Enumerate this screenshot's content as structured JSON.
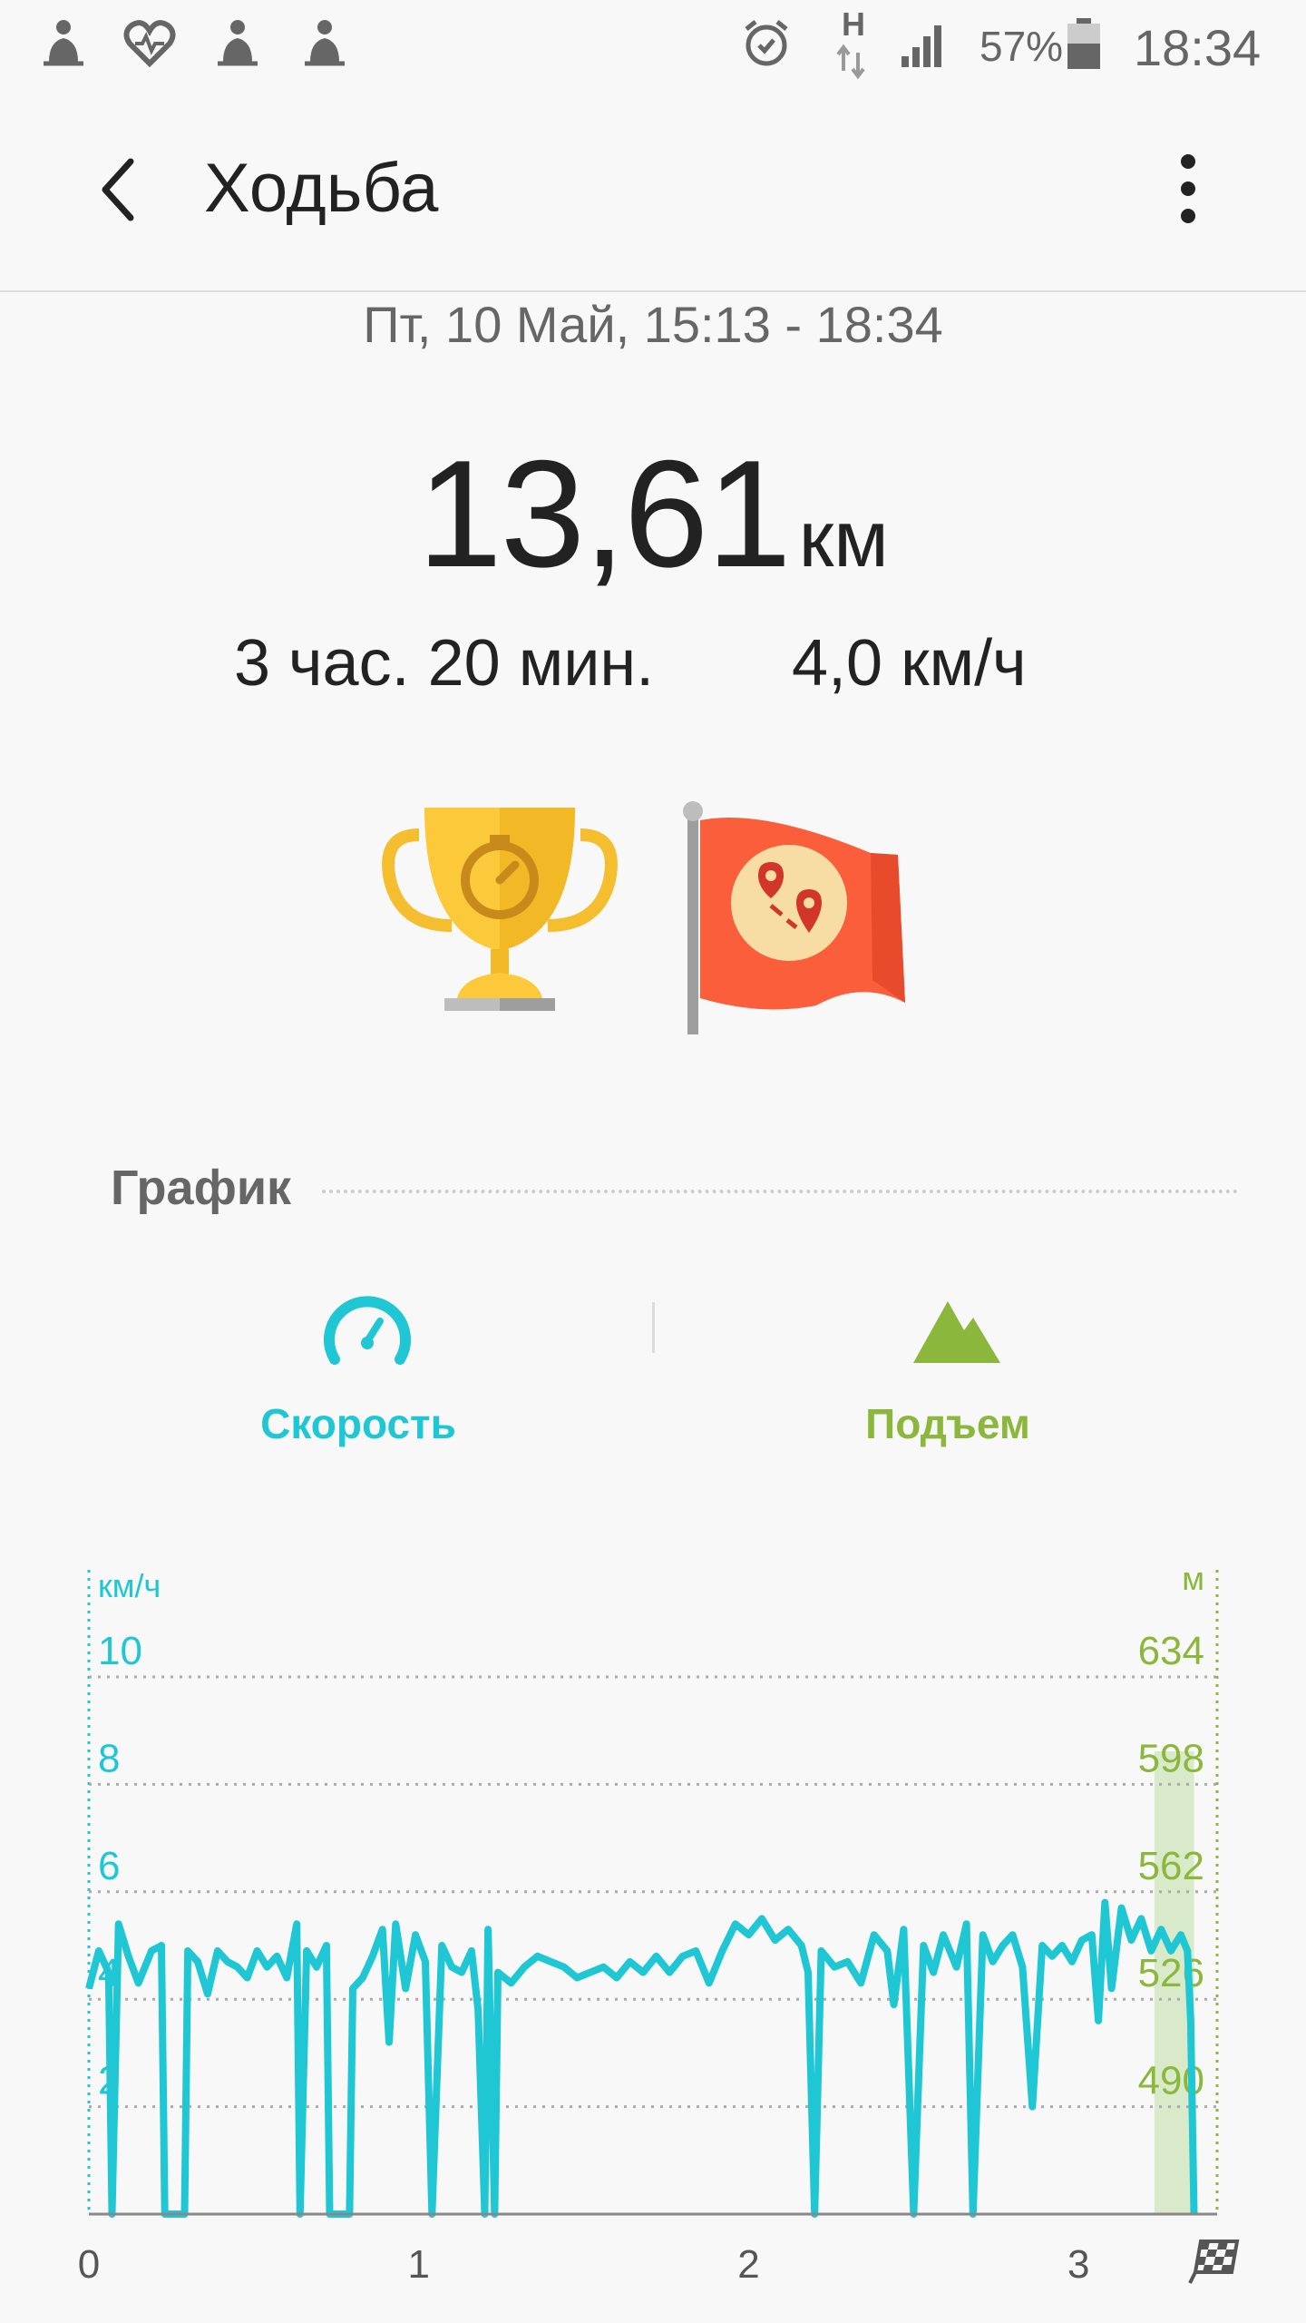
{
  "status_bar": {
    "battery": "57%",
    "time": "18:34",
    "network": "H",
    "icons": [
      "walking-notification-icon",
      "heart-notification-icon",
      "walking-notification-icon",
      "walking-notification-icon",
      "alarm-icon",
      "data-arrows-icon",
      "signal-icon",
      "battery-icon"
    ]
  },
  "app_bar": {
    "title": "Ходьба",
    "back_icon": "back-arrow-icon",
    "more_icon": "more-vertical-icon"
  },
  "workout": {
    "date_range": "Пт, 10 Май, 15:13 - 18:34",
    "distance_value": "13,61",
    "distance_unit": "км",
    "duration": "3 час. 20 мин.",
    "avg_speed": "4,0 км/ч"
  },
  "achievements": [
    "trophy-stopwatch-icon",
    "flag-route-icon"
  ],
  "graph_section": {
    "title": "График",
    "tabs": [
      {
        "label": "Скорость",
        "icon": "speedometer-icon",
        "color": "#1fc7d4"
      },
      {
        "label": "Подъем",
        "icon": "mountain-icon",
        "color": "#8ab73c"
      }
    ]
  },
  "chart_data": {
    "type": "line",
    "x_ticks": [
      "0",
      "1",
      "2",
      "3"
    ],
    "x_range": [
      0,
      3.42
    ],
    "left_axis": {
      "unit": "км/ч",
      "ticks": [
        "2",
        "4",
        "6",
        "8",
        "10"
      ],
      "range": [
        0,
        10
      ],
      "color": "#1fc7d4"
    },
    "right_axis": {
      "unit": "м",
      "ticks": [
        "490",
        "526",
        "562",
        "598",
        "634"
      ],
      "range": [
        454,
        634
      ],
      "color": "#8ab73c"
    },
    "finish_icon": "checkered-flag-icon",
    "grid": true,
    "series": [
      {
        "axis": "left",
        "color": "#1fc7d4",
        "points": [
          [
            0.0,
            4.2
          ],
          [
            0.03,
            4.9
          ],
          [
            0.06,
            4.5
          ],
          [
            0.07,
            0.0
          ],
          [
            0.09,
            5.4
          ],
          [
            0.12,
            4.8
          ],
          [
            0.15,
            4.3
          ],
          [
            0.19,
            4.9
          ],
          [
            0.22,
            5.0
          ],
          [
            0.23,
            0.0
          ],
          [
            0.29,
            0.0
          ],
          [
            0.3,
            4.9
          ],
          [
            0.33,
            4.7
          ],
          [
            0.36,
            4.1
          ],
          [
            0.39,
            4.9
          ],
          [
            0.42,
            4.7
          ],
          [
            0.45,
            4.6
          ],
          [
            0.48,
            4.4
          ],
          [
            0.51,
            4.9
          ],
          [
            0.54,
            4.6
          ],
          [
            0.57,
            4.8
          ],
          [
            0.6,
            4.4
          ],
          [
            0.63,
            5.4
          ],
          [
            0.64,
            0.0
          ],
          [
            0.66,
            4.9
          ],
          [
            0.69,
            4.6
          ],
          [
            0.72,
            5.0
          ],
          [
            0.73,
            0.0
          ],
          [
            0.79,
            0.0
          ],
          [
            0.8,
            4.2
          ],
          [
            0.83,
            4.4
          ],
          [
            0.86,
            4.8
          ],
          [
            0.89,
            5.3
          ],
          [
            0.91,
            3.2
          ],
          [
            0.93,
            5.4
          ],
          [
            0.96,
            4.2
          ],
          [
            0.99,
            5.2
          ],
          [
            1.02,
            4.7
          ],
          [
            1.04,
            0.0
          ],
          [
            1.07,
            5.0
          ],
          [
            1.1,
            4.6
          ],
          [
            1.13,
            4.5
          ],
          [
            1.16,
            4.9
          ],
          [
            1.18,
            3.8
          ],
          [
            1.2,
            0.0
          ],
          [
            1.21,
            5.3
          ],
          [
            1.23,
            0.0
          ],
          [
            1.24,
            4.5
          ],
          [
            1.28,
            4.3
          ],
          [
            1.32,
            4.6
          ],
          [
            1.36,
            4.8
          ],
          [
            1.4,
            4.7
          ],
          [
            1.44,
            4.6
          ],
          [
            1.48,
            4.4
          ],
          [
            1.52,
            4.5
          ],
          [
            1.56,
            4.6
          ],
          [
            1.6,
            4.4
          ],
          [
            1.64,
            4.7
          ],
          [
            1.68,
            4.5
          ],
          [
            1.72,
            4.8
          ],
          [
            1.76,
            4.5
          ],
          [
            1.8,
            4.8
          ],
          [
            1.84,
            4.9
          ],
          [
            1.88,
            4.3
          ],
          [
            1.92,
            4.9
          ],
          [
            1.96,
            5.4
          ],
          [
            2.0,
            5.2
          ],
          [
            2.04,
            5.5
          ],
          [
            2.08,
            5.1
          ],
          [
            2.12,
            5.3
          ],
          [
            2.16,
            5.0
          ],
          [
            2.18,
            4.5
          ],
          [
            2.2,
            0.0
          ],
          [
            2.22,
            4.9
          ],
          [
            2.26,
            4.6
          ],
          [
            2.3,
            4.7
          ],
          [
            2.34,
            4.3
          ],
          [
            2.38,
            5.2
          ],
          [
            2.42,
            4.9
          ],
          [
            2.44,
            3.9
          ],
          [
            2.47,
            5.3
          ],
          [
            2.5,
            0.0
          ],
          [
            2.53,
            5.0
          ],
          [
            2.56,
            4.5
          ],
          [
            2.59,
            5.2
          ],
          [
            2.63,
            4.6
          ],
          [
            2.66,
            5.4
          ],
          [
            2.68,
            0.0
          ],
          [
            2.71,
            5.2
          ],
          [
            2.74,
            4.7
          ],
          [
            2.77,
            5.0
          ],
          [
            2.8,
            5.2
          ],
          [
            2.83,
            4.6
          ],
          [
            2.86,
            2.0
          ],
          [
            2.89,
            5.0
          ],
          [
            2.92,
            4.8
          ],
          [
            2.95,
            5.0
          ],
          [
            2.98,
            4.7
          ],
          [
            3.01,
            5.1
          ],
          [
            3.04,
            5.2
          ],
          [
            3.06,
            3.6
          ],
          [
            3.08,
            5.8
          ],
          [
            3.1,
            4.2
          ],
          [
            3.13,
            5.7
          ],
          [
            3.16,
            5.1
          ],
          [
            3.19,
            5.5
          ],
          [
            3.22,
            4.9
          ],
          [
            3.25,
            5.3
          ],
          [
            3.28,
            4.9
          ],
          [
            3.31,
            5.2
          ],
          [
            3.33,
            4.9
          ],
          [
            3.34,
            3.6
          ],
          [
            3.35,
            0.0
          ]
        ]
      }
    ],
    "highlight_band": {
      "x_range": [
        3.23,
        3.35
      ],
      "color": "#d9eacb"
    }
  }
}
